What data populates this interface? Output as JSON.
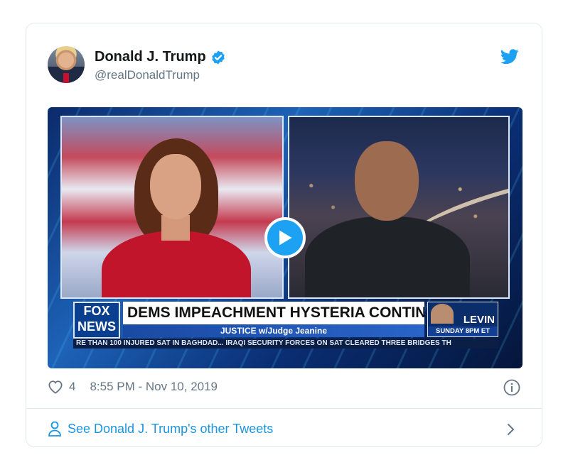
{
  "tweet": {
    "author_name": "Donald J. Trump",
    "handle": "@realDonaldTrump",
    "likes": "4",
    "timestamp": "8:55 PM - Nov 10, 2019",
    "footer_link": "See Donald J. Trump's other Tweets"
  },
  "video": {
    "network_logo_top": "FOX",
    "network_logo_bottom": "NEWS",
    "headline": "DEMS IMPEACHMENT HYSTERIA CONTINUES",
    "show_name": "JUSTICE w/Judge Jeanine",
    "promo_name": "LEVIN",
    "promo_time": "SUNDAY 8PM ET",
    "ticker": "RE THAN 100 INJURED SAT IN BAGHDAD...   IRAQI SECURITY FORCES ON SAT CLEARED THREE BRIDGES TH"
  },
  "colors": {
    "accent": "#1da1f2",
    "link": "#1b95e0",
    "muted": "#657786",
    "border": "#e1e8ed"
  },
  "icons": [
    "verified-badge-icon",
    "twitter-bird-icon",
    "play-icon",
    "heart-icon",
    "info-icon",
    "user-icon",
    "chevron-right-icon"
  ]
}
